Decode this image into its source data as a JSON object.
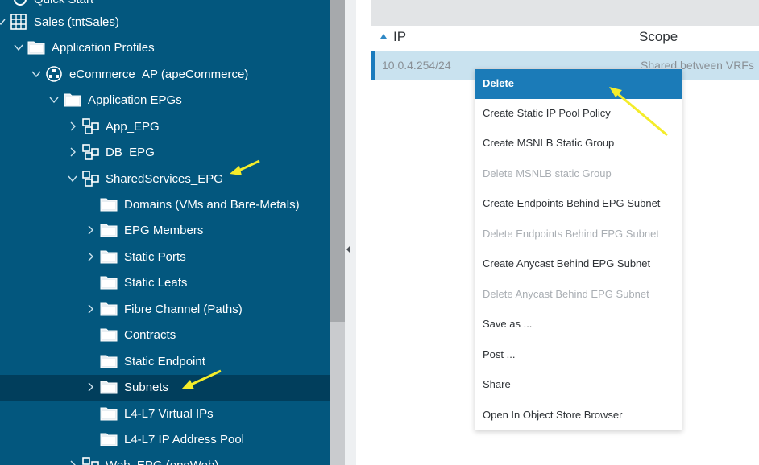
{
  "tree": {
    "items": [
      {
        "label": "Quick Start",
        "icon": "quick-start-icon",
        "chevron": "none"
      },
      {
        "label": "Sales (tntSales)",
        "icon": "tenant-grid-icon",
        "chevron": "down"
      },
      {
        "label": "Application Profiles",
        "icon": "folder-icon",
        "chevron": "down"
      },
      {
        "label": "eCommerce_AP (apeCommerce)",
        "icon": "app-profile-icon",
        "chevron": "down"
      },
      {
        "label": "Application EPGs",
        "icon": "folder-icon",
        "chevron": "down"
      },
      {
        "label": "App_EPG",
        "icon": "epg-icon",
        "chevron": "right"
      },
      {
        "label": "DB_EPG",
        "icon": "epg-icon",
        "chevron": "right"
      },
      {
        "label": "SharedServices_EPG",
        "icon": "epg-icon",
        "chevron": "down"
      },
      {
        "label": "Domains (VMs and Bare-Metals)",
        "icon": "folder-icon",
        "chevron": "none"
      },
      {
        "label": "EPG Members",
        "icon": "folder-icon",
        "chevron": "right"
      },
      {
        "label": "Static Ports",
        "icon": "folder-icon",
        "chevron": "right"
      },
      {
        "label": "Static Leafs",
        "icon": "folder-icon",
        "chevron": "none"
      },
      {
        "label": "Fibre Channel (Paths)",
        "icon": "folder-icon",
        "chevron": "right"
      },
      {
        "label": "Contracts",
        "icon": "folder-icon",
        "chevron": "none"
      },
      {
        "label": "Static Endpoint",
        "icon": "folder-icon",
        "chevron": "none"
      },
      {
        "label": "Subnets",
        "icon": "folder-icon",
        "chevron": "right",
        "selected": true
      },
      {
        "label": "L4-L7 Virtual IPs",
        "icon": "folder-icon",
        "chevron": "none"
      },
      {
        "label": "L4-L7 IP Address Pool",
        "icon": "folder-icon",
        "chevron": "none"
      },
      {
        "label": "Web_EPG (epgWeb)",
        "icon": "epg-icon",
        "chevron": "right"
      }
    ]
  },
  "table": {
    "columns": {
      "ip": "IP",
      "scope": "Scope"
    },
    "rows": [
      {
        "ip": "10.0.4.254/24",
        "scope": "Shared between VRFs"
      }
    ]
  },
  "context_menu": {
    "items": [
      {
        "label": "Delete",
        "state": "highlighted"
      },
      {
        "label": "Create Static IP Pool Policy",
        "state": "enabled"
      },
      {
        "label": "Create MSNLB Static Group",
        "state": "enabled"
      },
      {
        "label": "Delete MSNLB static Group",
        "state": "disabled"
      },
      {
        "label": "Create Endpoints Behind EPG Subnet",
        "state": "enabled"
      },
      {
        "label": "Delete Endpoints Behind EPG Subnet",
        "state": "disabled"
      },
      {
        "label": "Create Anycast Behind EPG Subnet",
        "state": "enabled"
      },
      {
        "label": "Delete Anycast Behind EPG Subnet",
        "state": "disabled"
      },
      {
        "label": "Save as ...",
        "state": "enabled"
      },
      {
        "label": "Post ...",
        "state": "enabled"
      },
      {
        "label": "Share",
        "state": "enabled"
      },
      {
        "label": "Open In Object Store Browser",
        "state": "enabled"
      }
    ]
  },
  "colors": {
    "tree_bg": "#03577e",
    "tree_selected": "#013e5c",
    "menu_highlight": "#1b7bb8",
    "row_selected": "#c9e2ef",
    "annotation_arrow": "#f4ec2a"
  }
}
